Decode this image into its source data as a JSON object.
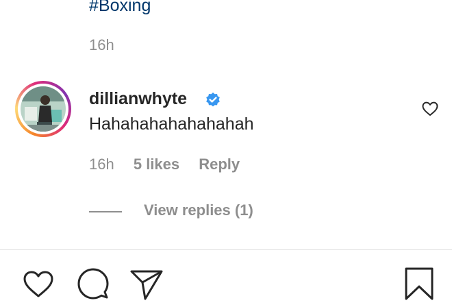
{
  "post": {
    "caption_tail": "#Boxing",
    "time": "16h"
  },
  "comment": {
    "username": "dillianwhyte",
    "verified": true,
    "text": "Hahahahahahahahah",
    "time": "16h",
    "likes": "5 likes",
    "reply_label": "Reply",
    "view_replies": "View replies (1)"
  },
  "icons": {
    "like_comment": "heart-outline-icon",
    "verified": "verified-badge-icon",
    "like_post": "heart-outline-icon",
    "comment": "speech-bubble-icon",
    "share": "paper-plane-icon",
    "save": "bookmark-icon"
  },
  "colors": {
    "link": "#00376b",
    "text": "#262626",
    "muted": "#8e8e8e",
    "verified": "#3897f0"
  }
}
